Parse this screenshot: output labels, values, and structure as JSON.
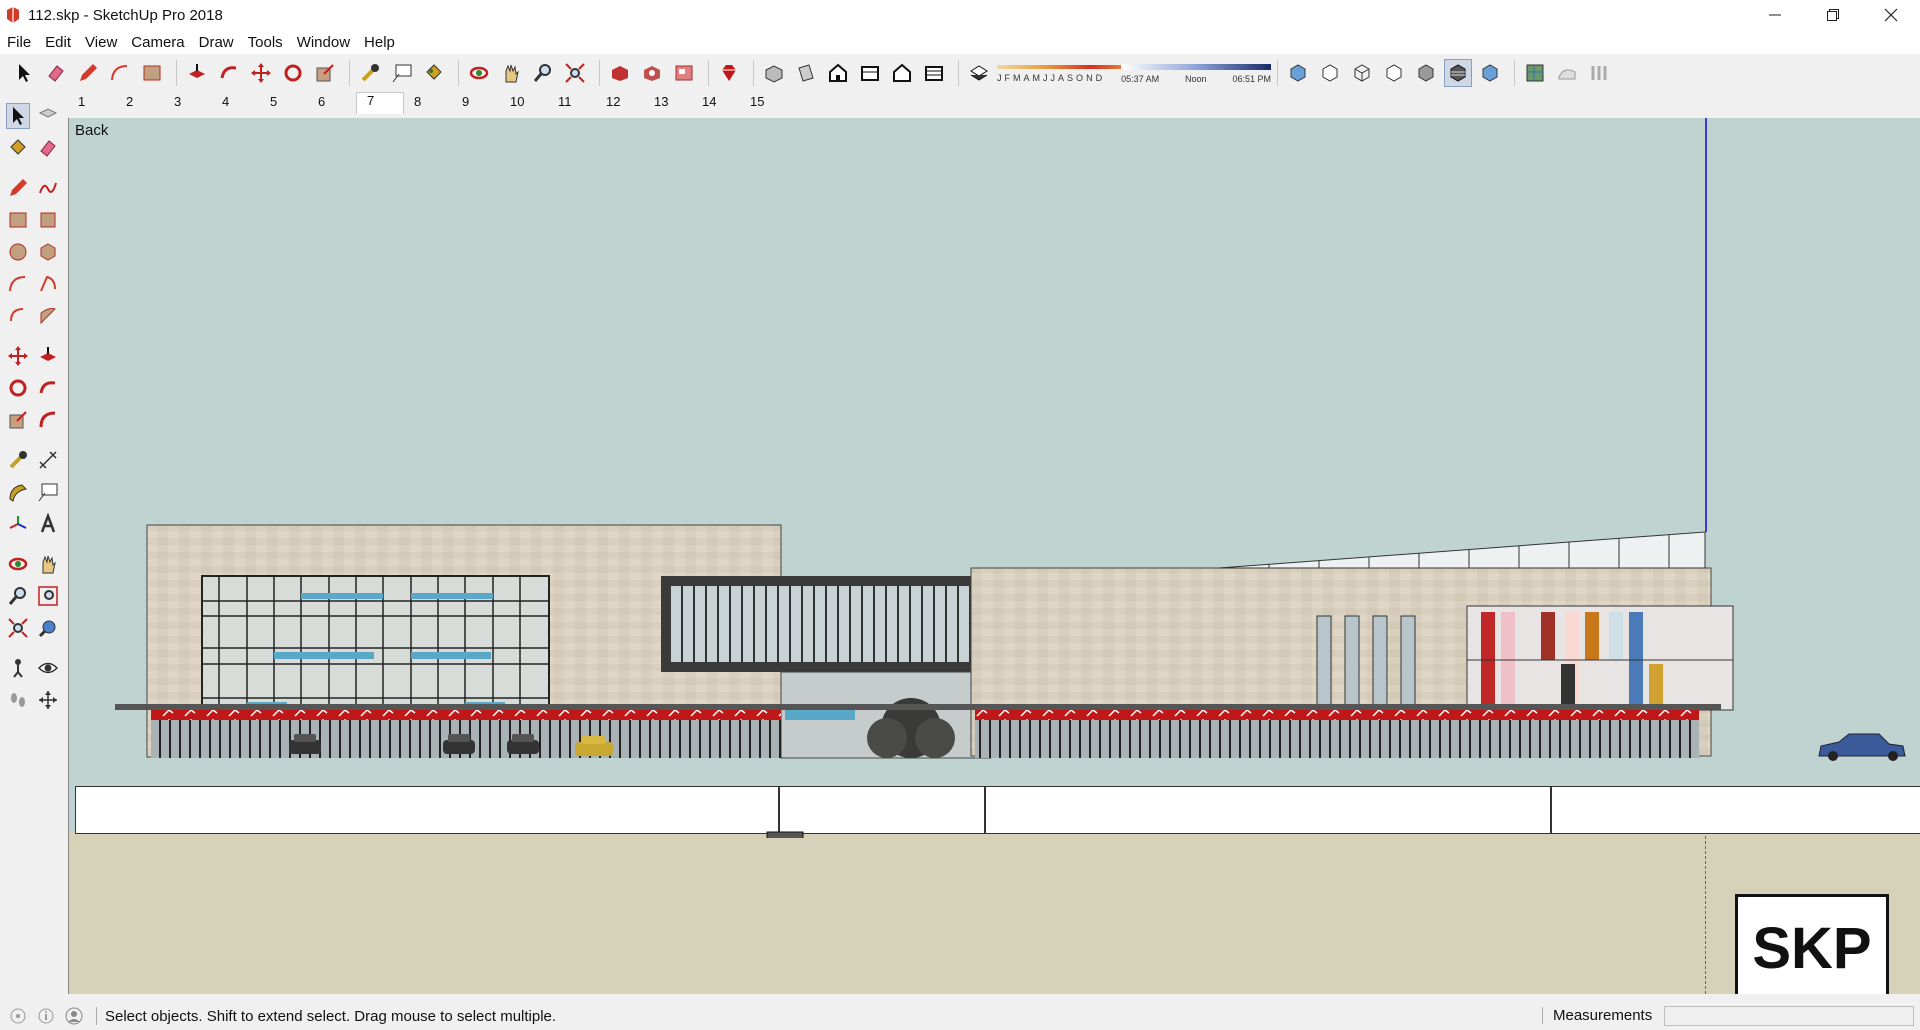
{
  "window": {
    "title": "112.skp - SketchUp Pro 2018"
  },
  "menu": [
    "File",
    "Edit",
    "View",
    "Camera",
    "Draw",
    "Tools",
    "Window",
    "Help"
  ],
  "shadow": {
    "months": [
      "J",
      "F",
      "M",
      "A",
      "M",
      "J",
      "J",
      "A",
      "S",
      "O",
      "N",
      "D"
    ],
    "sunrise": "05:37 AM",
    "noon": "Noon",
    "sunset": "06:51 PM"
  },
  "scenes": {
    "tabs": [
      "1",
      "2",
      "3",
      "4",
      "5",
      "6",
      "7",
      "8",
      "9",
      "10",
      "11",
      "12",
      "13",
      "14",
      "15"
    ],
    "active": "7"
  },
  "viewport": {
    "label": "Back",
    "logo": "SKP",
    "sky_color": "#bfd3d1",
    "ground_color": "#d5d2b9"
  },
  "status": {
    "text": "Select objects. Shift to extend select. Drag mouse to select multiple.",
    "measurements_label": "Measurements",
    "measurements_value": ""
  },
  "icons": {
    "toolbar": [
      "select-icon",
      "eraser-icon",
      "pencil-icon",
      "arc-icon",
      "rectangle-icon",
      "push-pull-icon",
      "follow-me-icon",
      "move-icon",
      "rotate-icon",
      "scale-icon",
      "tape-measure-icon",
      "text-icon",
      "paint-bucket-icon",
      "orbit-icon",
      "pan-icon",
      "zoom-icon",
      "zoom-extents-icon",
      "3d-warehouse-icon",
      "extension-warehouse-icon",
      "layout-icon",
      "ruby-icon",
      "iso-view-icon",
      "top-view-icon",
      "front-view-icon",
      "right-view-icon",
      "back-view-icon",
      "left-view-icon",
      "shadows-icon",
      "xray-icon",
      "back-edges-icon",
      "wireframe-icon",
      "hidden-line-icon",
      "shaded-icon",
      "shaded-textures-icon",
      "monochrome-icon",
      "add-location-icon",
      "sandbox-icon",
      "terrain-icon"
    ]
  }
}
